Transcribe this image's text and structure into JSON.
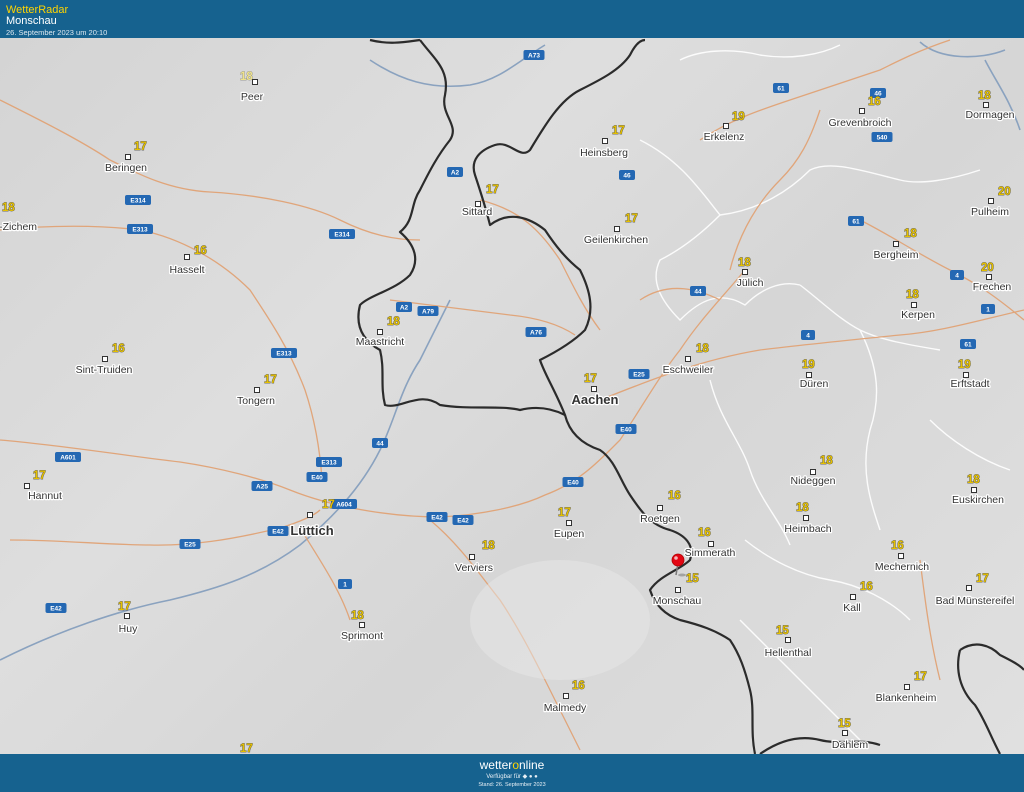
{
  "header": {
    "app_title": "WetterRadar",
    "location": "Monschau",
    "timestamp": "26. September 2023 um 20:10"
  },
  "footer": {
    "logo_prefix": "wetter",
    "logo_o": "o",
    "logo_suffix": "nline",
    "available": "Verfügbar für",
    "stand": "Stand: 26. September 2023"
  },
  "marker": {
    "name": "Monschau",
    "color": "#e30613"
  },
  "cities": [
    {
      "name": "Peer",
      "temp": "18",
      "pale": true
    },
    {
      "name": "Beringen",
      "temp": "17"
    },
    {
      "name": "el-Zichem",
      "temp": "18"
    },
    {
      "name": "Hasselt",
      "temp": "16"
    },
    {
      "name": "Sint-Truiden",
      "temp": "16"
    },
    {
      "name": "Tongern",
      "temp": "17"
    },
    {
      "name": "Maastricht",
      "temp": "18"
    },
    {
      "name": "Sittard",
      "temp": "17"
    },
    {
      "name": "Heinsberg",
      "temp": "17"
    },
    {
      "name": "Erkelenz",
      "temp": "19"
    },
    {
      "name": "Grevenbroich",
      "temp": "16"
    },
    {
      "name": "Dormagen",
      "temp": "18"
    },
    {
      "name": "Geilenkirchen",
      "temp": "17"
    },
    {
      "name": "Pulheim",
      "temp": "20"
    },
    {
      "name": "Bergheim",
      "temp": "18"
    },
    {
      "name": "Jülich",
      "temp": "18"
    },
    {
      "name": "Frechen",
      "temp": "20"
    },
    {
      "name": "Kerpen",
      "temp": "18"
    },
    {
      "name": "Eschweiler",
      "temp": "18"
    },
    {
      "name": "Düren",
      "temp": "19"
    },
    {
      "name": "Erftstadt",
      "temp": "19"
    },
    {
      "name": "Aachen",
      "temp": "17",
      "big": true
    },
    {
      "name": "Hannut",
      "temp": "17"
    },
    {
      "name": "Lüttich",
      "temp": "17",
      "big": true
    },
    {
      "name": "Nideggen",
      "temp": "18"
    },
    {
      "name": "Euskirchen",
      "temp": "18"
    },
    {
      "name": "Roetgen",
      "temp": "16"
    },
    {
      "name": "Heimbach",
      "temp": "18"
    },
    {
      "name": "Eupen",
      "temp": "17"
    },
    {
      "name": "Verviers",
      "temp": "18"
    },
    {
      "name": "Simmerath",
      "temp": "16"
    },
    {
      "name": "Mechernich",
      "temp": "16"
    },
    {
      "name": "Monschau",
      "temp": "15"
    },
    {
      "name": "Bad Münstereifel",
      "temp": "17"
    },
    {
      "name": "Kall",
      "temp": "16"
    },
    {
      "name": "Huy",
      "temp": "17"
    },
    {
      "name": "Sprimont",
      "temp": "18"
    },
    {
      "name": "Hellenthal",
      "temp": "15"
    },
    {
      "name": "Malmedy",
      "temp": "16"
    },
    {
      "name": "Blankenheim",
      "temp": "17"
    },
    {
      "name": "Dahlem",
      "temp": "15"
    },
    {
      "name": "",
      "temp": "17"
    }
  ],
  "road_labels": [
    "A73",
    "46",
    "61",
    "540",
    "A2",
    "46",
    "E314",
    "E313",
    "E314",
    "61",
    "4",
    "A2",
    "A79",
    "44",
    "A76",
    "1",
    "E313",
    "4",
    "61",
    "E25",
    "44",
    "E40",
    "A601",
    "E313",
    "E40",
    "A25",
    "E40",
    "E42",
    "A604",
    "E42",
    "E25",
    "E42",
    "1",
    "E42"
  ]
}
